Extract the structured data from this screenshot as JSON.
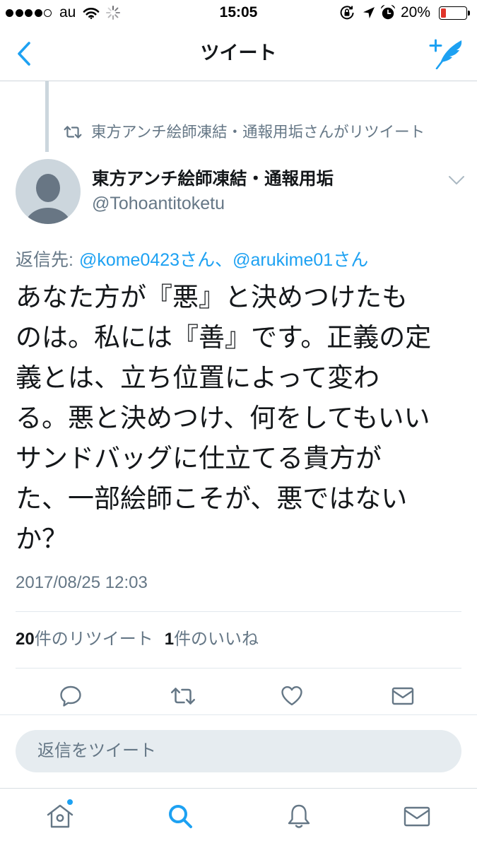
{
  "status_bar": {
    "signal_strength": 4,
    "signal_max": 5,
    "carrier": "au",
    "time": "15:05",
    "battery_text": "20%",
    "battery_level": 0.2
  },
  "nav": {
    "title": "ツイート",
    "back_icon": "chevron-left-icon",
    "compose_icon": "compose-tweet-icon"
  },
  "retweet_context": {
    "icon": "retweet-icon",
    "text": "東方アンチ絵師凍結・通報用垢さんがリツイート"
  },
  "tweet": {
    "author": {
      "name": "東方アンチ絵師凍結・通報用垢",
      "handle": "@Tohoantitoketu",
      "avatar_icon": "default-profile-icon"
    },
    "menu_icon": "chevron-down-icon",
    "reply_to": {
      "label": "返信先:",
      "mentions": [
        "@kome0423さん",
        "@arukime01さん"
      ],
      "separator": "、"
    },
    "text_lines": [
      "あなた方が『悪』と決めつけたも",
      "のは。私には『善』です。正義の定",
      "義とは、立ち位置によって変わ",
      "る。悪と決めつけ、何をしてもいい",
      "サンドバッグに仕立てる貴方が",
      "た、一部絵師こそが、悪ではない",
      "か？"
    ],
    "timestamp": "2017/08/25 12:03"
  },
  "stats": {
    "retweets_count": "20",
    "retweets_label": "件のリツイート",
    "likes_count": "1",
    "likes_label": "件のいいね"
  },
  "actions": [
    {
      "icon": "reply-icon"
    },
    {
      "icon": "retweet-icon"
    },
    {
      "icon": "heart-icon"
    },
    {
      "icon": "direct-message-icon"
    }
  ],
  "reply_box": {
    "placeholder": "返信をツイート"
  },
  "tab_bar": {
    "items": [
      {
        "icon": "home-icon",
        "badge": true
      },
      {
        "icon": "search-icon",
        "active": true
      },
      {
        "icon": "notifications-bell-icon"
      },
      {
        "icon": "messages-mail-icon"
      }
    ]
  },
  "colors": {
    "accent": "#1da1f2",
    "text": "#14171a",
    "secondary_text": "#657786",
    "icon_gray": "#657786",
    "divider": "#e1e8ed",
    "thread_line": "#ccd6dd",
    "input_bg": "#e6ecf0",
    "battery_low": "#e0352b",
    "avatar_bg": "#ccd6dd",
    "avatar_fg": "#687684"
  }
}
